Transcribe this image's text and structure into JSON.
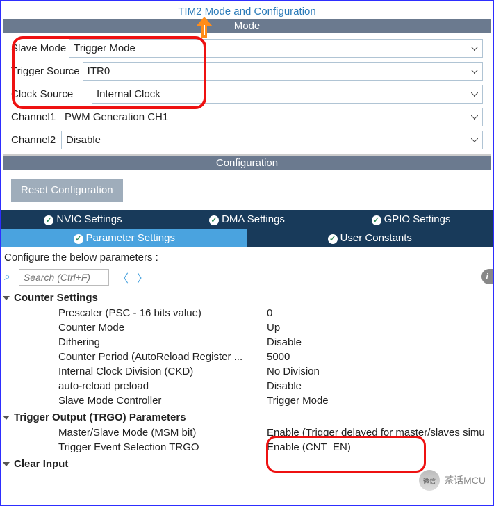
{
  "title": "TIM2 Mode and Configuration",
  "mode_header": "Mode",
  "config_header": "Configuration",
  "mode_fields": {
    "slave_mode": {
      "label": "Slave Mode",
      "value": "Trigger Mode"
    },
    "trigger_source": {
      "label": "Trigger Source",
      "value": "ITR0"
    },
    "clock_source": {
      "label": "Clock Source",
      "value": "Internal Clock"
    },
    "channel1": {
      "label": "Channel1",
      "value": "PWM Generation CH1"
    },
    "channel2": {
      "label": "Channel2",
      "value": "Disable"
    }
  },
  "reset_btn": "Reset Configuration",
  "tabs_row1": {
    "nvic": "NVIC Settings",
    "dma": "DMA Settings",
    "gpio": "GPIO Settings"
  },
  "tabs_row2": {
    "param": "Parameter Settings",
    "user": "User Constants"
  },
  "hint": "Configure the below parameters :",
  "search_placeholder": "Search (Ctrl+F)",
  "tree": {
    "counter": {
      "title": "Counter Settings",
      "rows": [
        {
          "l": "Prescaler (PSC - 16 bits value)",
          "v": "0"
        },
        {
          "l": "Counter Mode",
          "v": "Up"
        },
        {
          "l": "Dithering",
          "v": "Disable"
        },
        {
          "l": "Counter Period (AutoReload Register ...",
          "v": "5000"
        },
        {
          "l": "Internal Clock Division (CKD)",
          "v": "No Division"
        },
        {
          "l": "auto-reload preload",
          "v": "Disable"
        },
        {
          "l": "Slave Mode Controller",
          "v": "Trigger Mode"
        }
      ]
    },
    "trgo": {
      "title": "Trigger Output (TRGO) Parameters",
      "rows": [
        {
          "l": "Master/Slave Mode (MSM bit)",
          "v": "Enable (Trigger delayed for master/slaves simu"
        },
        {
          "l": "Trigger Event Selection TRGO",
          "v": "Enable (CNT_EN)"
        }
      ]
    },
    "clear": {
      "title": "Clear Input"
    }
  },
  "watermark": "茶话MCU"
}
